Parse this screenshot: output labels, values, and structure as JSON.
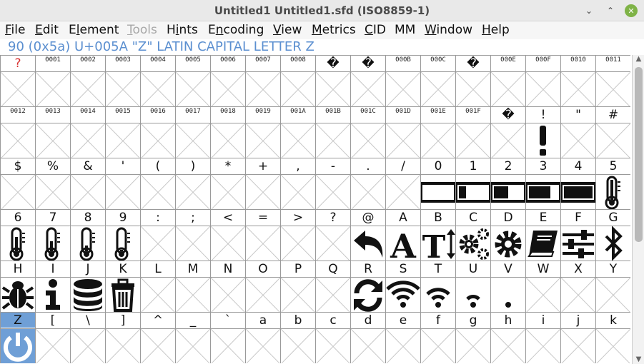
{
  "window": {
    "title": "Untitled1  Untitled1.sfd (ISO8859-1)",
    "controls": {
      "minimize": "⌄",
      "maximize": "⌃",
      "close": "✕"
    }
  },
  "menu": [
    {
      "pre": "",
      "ul": "F",
      "post": "ile",
      "enabled": true
    },
    {
      "pre": "",
      "ul": "E",
      "post": "dit",
      "enabled": true
    },
    {
      "pre": "E",
      "ul": "l",
      "post": "ement",
      "enabled": true
    },
    {
      "pre": "",
      "ul": "T",
      "post": "ools",
      "enabled": false
    },
    {
      "pre": "H",
      "ul": "i",
      "post": "nts",
      "enabled": true
    },
    {
      "pre": "E",
      "ul": "n",
      "post": "coding",
      "enabled": true
    },
    {
      "pre": "",
      "ul": "V",
      "post": "iew",
      "enabled": true
    },
    {
      "pre": "",
      "ul": "M",
      "post": "etrics",
      "enabled": true
    },
    {
      "pre": "",
      "ul": "C",
      "post": "ID",
      "enabled": true
    },
    {
      "pre": "MM",
      "ul": "",
      "post": "",
      "enabled": true
    },
    {
      "pre": "",
      "ul": "W",
      "post": "indow",
      "enabled": true
    },
    {
      "pre": "",
      "ul": "H",
      "post": "elp",
      "enabled": true
    }
  ],
  "info": "90 (0x5a) U+005A \"Z\" LATIN CAPITAL LETTER Z",
  "rows": [
    [
      "?",
      "0001",
      "0002",
      "0003",
      "0004",
      "0005",
      "0006",
      "0007",
      "0008",
      "�",
      "�",
      "000B",
      "000C",
      "�",
      "000E",
      "000F",
      "0010",
      "0011"
    ],
    [
      "0012",
      "0013",
      "0014",
      "0015",
      "0016",
      "0017",
      "0018",
      "0019",
      "001A",
      "001B",
      "001C",
      "001D",
      "001E",
      "001F",
      "�",
      "!",
      "\"",
      "#"
    ],
    [
      "$",
      "%",
      "&",
      "'",
      "(",
      ")",
      "*",
      "+",
      ",",
      "-",
      ".",
      "/",
      "0",
      "1",
      "2",
      "3",
      "4",
      "5"
    ],
    [
      "6",
      "7",
      "8",
      "9",
      ":",
      ";",
      "<",
      "=",
      ">",
      "?",
      "@",
      "A",
      "B",
      "C",
      "D",
      "E",
      "F",
      "G"
    ],
    [
      "H",
      "I",
      "J",
      "K",
      "L",
      "M",
      "N",
      "O",
      "P",
      "Q",
      "R",
      "S",
      "T",
      "U",
      "V",
      "W",
      "X",
      "Y"
    ],
    [
      "Z",
      "[",
      "\\",
      "]",
      "^",
      "_",
      "`",
      "a",
      "b",
      "c",
      "d",
      "e",
      "f",
      "g",
      "h",
      "i",
      "j",
      "k"
    ]
  ],
  "glyphs": {
    "1-15": "exclamation-glyph",
    "2-12": "battery-empty-glyph",
    "2-13": "battery-quarter-glyph",
    "2-14": "battery-half-glyph",
    "2-15": "battery-three-quarters-glyph",
    "2-16": "battery-full-glyph",
    "2-17": "thermometer-full-glyph",
    "3-0": "thermometer-three-quarters-glyph",
    "3-1": "thermometer-half-glyph",
    "3-2": "thermometer-quarter-glyph",
    "3-3": "thermometer-empty-glyph",
    "3-10": "undo-glyph",
    "3-11": "font-glyph",
    "3-12": "text-height-glyph",
    "3-13": "cogs-glyph",
    "3-14": "cog-glyph",
    "3-15": "book-glyph",
    "3-16": "sliders-glyph",
    "3-17": "bluetooth-glyph",
    "4-0": "bug-glyph",
    "4-1": "info-glyph",
    "4-2": "database-glyph",
    "4-3": "trash-glyph",
    "4-10": "sync-glyph",
    "4-11": "wifi-full-glyph",
    "4-12": "wifi-medium-glyph",
    "4-13": "wifi-low-glyph",
    "4-14": "wifi-dot-glyph",
    "5-0": "power-glyph"
  },
  "colors": {
    "selection": "#6f9fd6",
    "info_text": "#5b8fd0",
    "missing_glyph": "#d83030",
    "close_button": "#7fb347"
  }
}
